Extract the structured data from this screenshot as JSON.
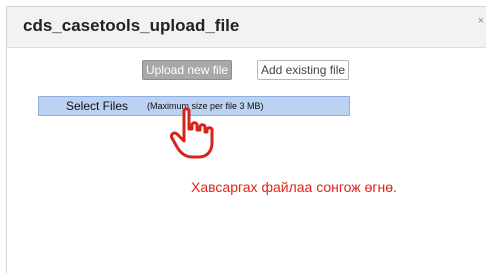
{
  "dialog": {
    "title": "cds_casetools_upload_file",
    "close_label": "×"
  },
  "tabs": [
    {
      "label": "Upload new file",
      "active": true
    },
    {
      "label": "Add existing file",
      "active": false
    }
  ],
  "uploader": {
    "select_label": "Select Files",
    "size_note": "(Maximum size per file 3 MB)"
  },
  "annotation": {
    "text": "Хавсаргах файлаа сонгож өгнө.",
    "color": "#e2231a"
  },
  "icons": {
    "cursor": "hand-pointer-icon"
  },
  "colors": {
    "select_bar": "#bcd2f2",
    "active_tab": "#a8a8a8"
  }
}
